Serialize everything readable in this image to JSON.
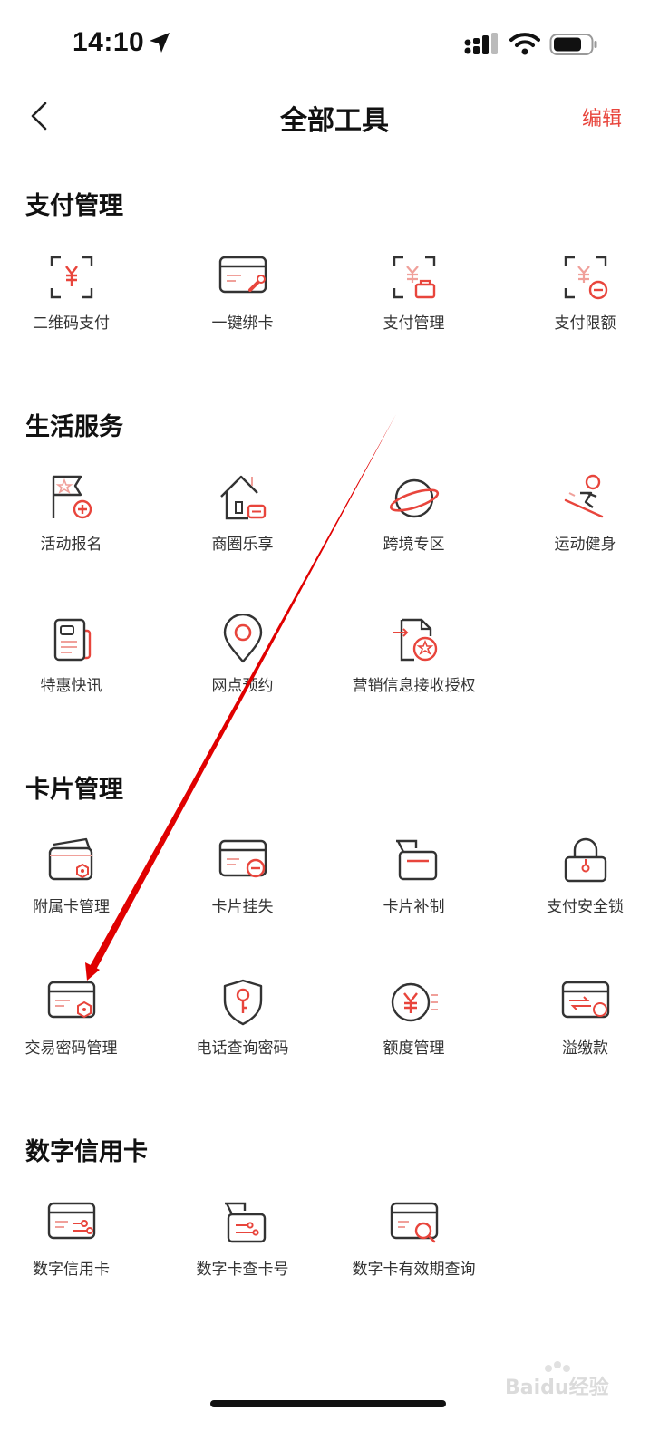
{
  "status_bar": {
    "time": "14:10"
  },
  "nav": {
    "title": "全部工具",
    "edit_label": "编辑"
  },
  "sections": [
    {
      "title": "支付管理",
      "items": [
        {
          "label": "二维码支付",
          "icon": "qr-pay-icon"
        },
        {
          "label": "一键绑卡",
          "icon": "bind-card-icon"
        },
        {
          "label": "支付管理",
          "icon": "pay-manage-icon"
        },
        {
          "label": "支付限额",
          "icon": "pay-limit-icon"
        }
      ]
    },
    {
      "title": "生活服务",
      "items": [
        {
          "label": "活动报名",
          "icon": "activity-flag-icon"
        },
        {
          "label": "商圈乐享",
          "icon": "shop-house-icon"
        },
        {
          "label": "跨境专区",
          "icon": "planet-icon"
        },
        {
          "label": "运动健身",
          "icon": "ski-icon"
        },
        {
          "label": "特惠快讯",
          "icon": "news-card-icon"
        },
        {
          "label": "网点预约",
          "icon": "location-pin-icon"
        },
        {
          "label": "营销信息接收授权",
          "icon": "authorize-doc-icon"
        }
      ]
    },
    {
      "title": "卡片管理",
      "items": [
        {
          "label": "附属卡管理",
          "icon": "sub-card-icon"
        },
        {
          "label": "卡片挂失",
          "icon": "card-loss-icon"
        },
        {
          "label": "卡片补制",
          "icon": "card-reissue-icon"
        },
        {
          "label": "支付安全锁",
          "icon": "lock-icon"
        },
        {
          "label": "交易密码管理",
          "icon": "trade-password-icon"
        },
        {
          "label": "电话查询密码",
          "icon": "shield-key-icon"
        },
        {
          "label": "额度管理",
          "icon": "quota-yen-icon"
        },
        {
          "label": "溢缴款",
          "icon": "overpay-card-icon"
        }
      ]
    },
    {
      "title": "数字信用卡",
      "items": [
        {
          "label": "数字信用卡",
          "icon": "digital-card-icon"
        },
        {
          "label": "数字卡查卡号",
          "icon": "digital-card-number-icon"
        },
        {
          "label": "数字卡有效期查询",
          "icon": "digital-card-expiry-icon"
        }
      ]
    }
  ],
  "watermark": {
    "text": "Baidu经验"
  },
  "colors": {
    "accent": "#e8453c",
    "text": "#333333",
    "title": "#111111"
  }
}
